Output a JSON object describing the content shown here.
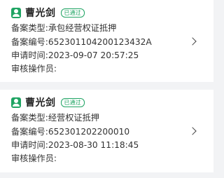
{
  "records": [
    {
      "name": "曹光剑",
      "badge": "已通过",
      "type_line": "备案类型:承包经营权证抵押",
      "number_line": "备案编号:65230110420012343 2A",
      "time_line": "申请时间:2023-09-07 20:57:25",
      "operator_line": "审核操作员:"
    },
    {
      "name": "曹光剑",
      "badge": "已通过",
      "type_line": "备案类型:经营权证抵押",
      "number_line": "备案编号:652301202200010",
      "time_line": "申请时间:2023-08-30 11:18:45",
      "operator_line": "审核操作员:"
    }
  ],
  "icons": {
    "person": "person-icon",
    "arrow": "chevron-right-icon"
  },
  "colors": {
    "accent": "#1fa463",
    "background": "#f2f3f5",
    "card": "#ffffff"
  }
}
